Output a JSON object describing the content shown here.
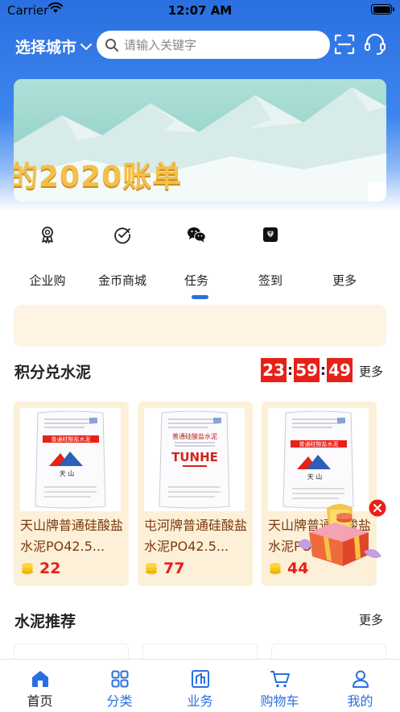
{
  "status_bar": {
    "carrier": "Carrier",
    "time": "12:07 AM"
  },
  "header": {
    "city_label": "选择城市"
  },
  "search": {
    "placeholder": "请输入关键字"
  },
  "banner": {
    "text": "的2020账单"
  },
  "nav": [
    {
      "label": "企业购",
      "icon": "award-ribbon-icon"
    },
    {
      "label": "金币商城",
      "icon": "check-circle-icon"
    },
    {
      "label": "任务",
      "icon": "wechat-icon"
    },
    {
      "label": "签到",
      "icon": "diamond-icon"
    },
    {
      "label": "更多",
      "icon": ""
    }
  ],
  "points_section": {
    "title": "积分兑水泥",
    "more": "更多",
    "countdown": {
      "hours": "23",
      "minutes": "59",
      "seconds": "49"
    },
    "products": [
      {
        "name": "天山牌普通硅酸盐水泥PO42.5...",
        "coins": "22",
        "bag_brand": "天 山",
        "bag_title": "普通硅酸盐水泥"
      },
      {
        "name": "屯河牌普通硅酸盐水泥PO42.5...",
        "coins": "77",
        "bag_brand": "TUNHE",
        "bag_title": "普通硅酸盐水泥"
      },
      {
        "name": "天山牌普通硅酸盐水泥PO42.5...",
        "coins": "44",
        "bag_brand": "天 山",
        "bag_title": "普通硅酸盐水泥"
      }
    ]
  },
  "recommend_section": {
    "title": "水泥推荐",
    "more": "更多"
  },
  "tabbar": [
    {
      "label": "首页",
      "icon": "home-icon"
    },
    {
      "label": "分类",
      "icon": "grid-icon"
    },
    {
      "label": "业务",
      "icon": "building-icon"
    },
    {
      "label": "购物车",
      "icon": "cart-icon"
    },
    {
      "label": "我的",
      "icon": "person-icon"
    }
  ],
  "colors": {
    "primary": "#2a6fe0",
    "countdown_red": "#e8201a",
    "card_bg": "#fdf0d8",
    "product_name": "#7a3a10"
  }
}
